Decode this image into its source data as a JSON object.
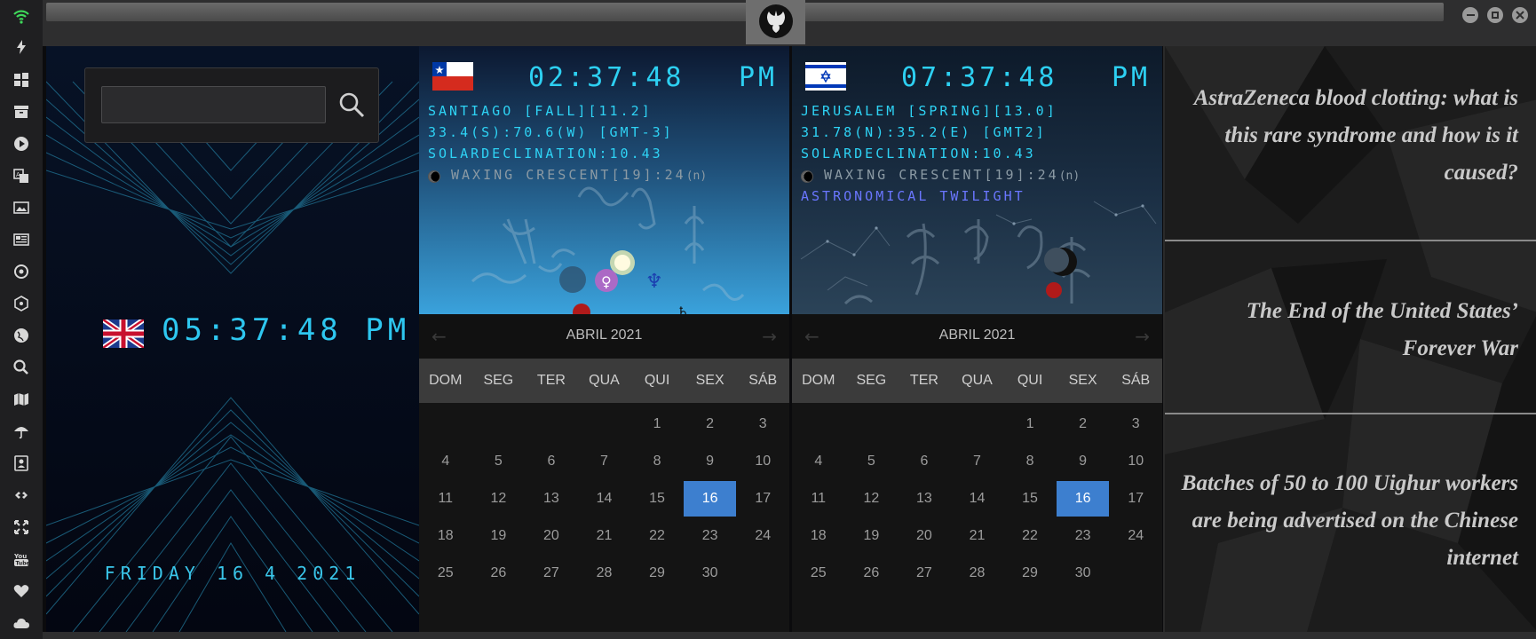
{
  "rail": {
    "icons": [
      "wifi-icon",
      "lightning-icon",
      "windows-icon",
      "archive-icon",
      "play-icon",
      "translate-icon",
      "image-icon",
      "newspaper-icon",
      "settings-icon",
      "hexagon-icon",
      "globe-icon",
      "search-icon",
      "map-icon",
      "umbrella-icon",
      "contacts-icon",
      "link-icon",
      "fullscreen-icon",
      "youtube-icon",
      "heart-icon",
      "cloud-icon"
    ]
  },
  "world": {
    "local_time": "05:37:48 PM",
    "local_date": "FRIDAY 16 4 2021",
    "search_placeholder": ""
  },
  "cities": [
    {
      "flag": "chile",
      "time": "02:37:48",
      "ampm": "PM",
      "line1": "SANTIAGO [FALL][11.2]",
      "line2": "33.4(S):70.6(W) [GMT-3]",
      "line3": "SOLARDECLINATION:10.43",
      "moon": "WAXING CRESCENT[19]:24",
      "moon_suffix": "(n)",
      "twilight": "",
      "calendar": {
        "month": "ABRIL 2021",
        "weekdays": [
          "DOM",
          "SEG",
          "TER",
          "QUA",
          "QUI",
          "SEX",
          "SÁB"
        ],
        "days": [
          "",
          "",
          "",
          "",
          "1",
          "2",
          "3",
          "4",
          "5",
          "6",
          "7",
          "8",
          "9",
          "10",
          "11",
          "12",
          "13",
          "14",
          "15",
          "16",
          "17",
          "18",
          "19",
          "20",
          "21",
          "22",
          "23",
          "24",
          "25",
          "26",
          "27",
          "28",
          "29",
          "30",
          ""
        ],
        "today": "16"
      }
    },
    {
      "flag": "israel",
      "time": "07:37:48",
      "ampm": "PM",
      "line1": "JERUSALEM [SPRING][13.0]",
      "line2": "31.78(N):35.2(E) [GMT2]",
      "line3": "SOLARDECLINATION:10.43",
      "moon": "WAXING CRESCENT[19]:24",
      "moon_suffix": "(n)",
      "twilight": "ASTRONOMICAL TWILIGHT",
      "calendar": {
        "month": "ABRIL 2021",
        "weekdays": [
          "DOM",
          "SEG",
          "TER",
          "QUA",
          "QUI",
          "SEX",
          "SÁB"
        ],
        "days": [
          "",
          "",
          "",
          "",
          "1",
          "2",
          "3",
          "4",
          "5",
          "6",
          "7",
          "8",
          "9",
          "10",
          "11",
          "12",
          "13",
          "14",
          "15",
          "16",
          "17",
          "18",
          "19",
          "20",
          "21",
          "22",
          "23",
          "24",
          "25",
          "26",
          "27",
          "28",
          "29",
          "30",
          ""
        ],
        "today": "16"
      }
    }
  ],
  "news": [
    "AstraZeneca blood clotting: what is this rare syndrome and how is it caused?",
    "The End of the United States’ Forever War",
    "Batches of 50 to 100 Uighur workers are being advertised on the Chinese internet"
  ],
  "colors": {
    "accent": "#2ed3f5",
    "today": "#3d7fcf",
    "twilight": "#6a76ff"
  }
}
